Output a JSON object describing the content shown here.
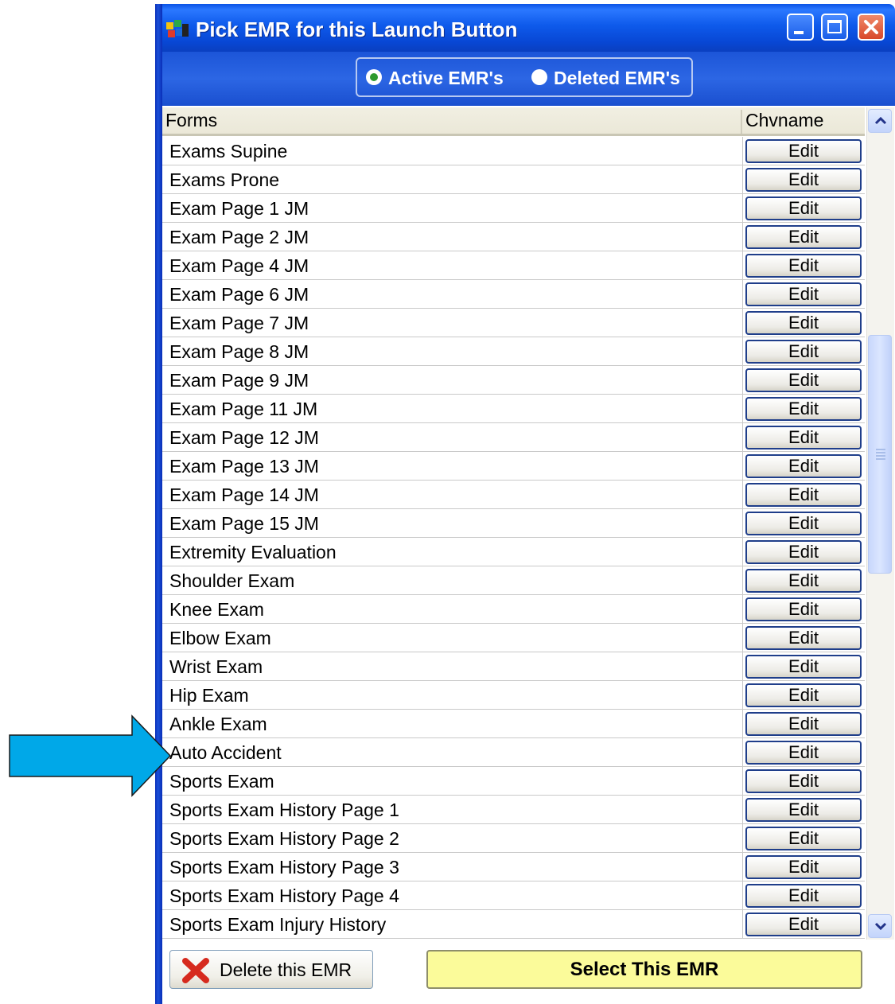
{
  "window": {
    "title": "Pick EMR for this Launch Button"
  },
  "filter": {
    "options": [
      {
        "label": "Active EMR's",
        "checked": true
      },
      {
        "label": "Deleted EMR's",
        "checked": false
      }
    ]
  },
  "grid": {
    "columns": [
      "Forms",
      "Chvname"
    ],
    "edit_label": "Edit",
    "rows": [
      "Exams Supine",
      "Exams Prone",
      "Exam Page 1 JM",
      "Exam Page 2 JM",
      "Exam Page 4 JM",
      "Exam Page 6 JM",
      "Exam Page 7 JM",
      "Exam Page 8 JM",
      "Exam Page 9 JM",
      "Exam Page 11 JM",
      "Exam Page 12 JM",
      "Exam Page 13 JM",
      "Exam Page 14 JM",
      "Exam Page 15 JM",
      "Extremity Evaluation",
      "Shoulder Exam",
      "Knee Exam",
      "Elbow Exam",
      "Wrist Exam",
      "Hip Exam",
      "Ankle Exam",
      "Auto Accident",
      "Sports Exam",
      "Sports Exam History Page 1",
      "Sports Exam History Page 2",
      "Sports Exam History Page 3",
      "Sports Exam History Page 4",
      "Sports Exam Injury History"
    ]
  },
  "footer": {
    "delete_label": "Delete this EMR",
    "select_label": "Select This EMR"
  },
  "annotation": {
    "arrow_color": "#00a8e8",
    "points_to_row": "Auto Accident"
  },
  "colors": {
    "titlebar": "#0a53e6",
    "select_button": "#fbfb9a",
    "radio_checked": "#2e9a2e",
    "delete_icon": "#d62a1e"
  }
}
